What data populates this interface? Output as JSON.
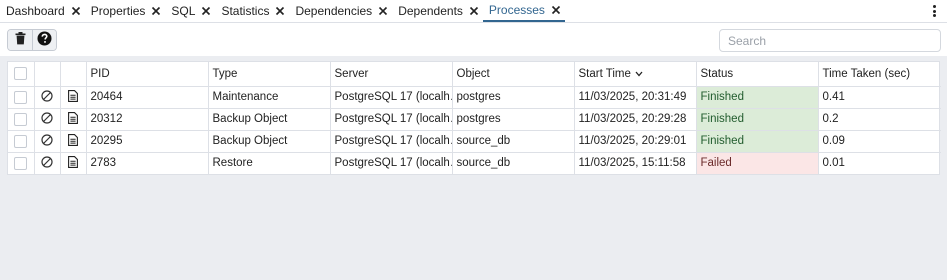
{
  "tabs": [
    {
      "label": "Dashboard",
      "active": false
    },
    {
      "label": "Properties",
      "active": false
    },
    {
      "label": "SQL",
      "active": false
    },
    {
      "label": "Statistics",
      "active": false
    },
    {
      "label": "Dependencies",
      "active": false
    },
    {
      "label": "Dependents",
      "active": false
    },
    {
      "label": "Processes",
      "active": true
    }
  ],
  "toolbar": {
    "delete_icon": "trash-icon",
    "help_icon": "help-circle-icon",
    "search_placeholder": "Search"
  },
  "table": {
    "columns": [
      "PID",
      "Type",
      "Server",
      "Object",
      "Start Time",
      "Status",
      "Time Taken (sec)"
    ],
    "sorted_column": "Start Time",
    "rows": [
      {
        "pid": "20464",
        "type": "Maintenance",
        "server": "PostgreSQL 17 (localh…",
        "object": "postgres",
        "start_time": "11/03/2025, 20:31:49",
        "status": "Finished",
        "time_taken": "0.41"
      },
      {
        "pid": "20312",
        "type": "Backup Object",
        "server": "PostgreSQL 17 (localh…",
        "object": "postgres",
        "start_time": "11/03/2025, 20:29:28",
        "status": "Finished",
        "time_taken": "0.2"
      },
      {
        "pid": "20295",
        "type": "Backup Object",
        "server": "PostgreSQL 17 (localh…",
        "object": "source_db",
        "start_time": "11/03/2025, 20:29:01",
        "status": "Finished",
        "time_taken": "0.09"
      },
      {
        "pid": "2783",
        "type": "Restore",
        "server": "PostgreSQL 17 (localh…",
        "object": "source_db",
        "start_time": "11/03/2025, 15:11:58",
        "status": "Failed",
        "time_taken": "0.01"
      }
    ]
  },
  "colors": {
    "accent": "#326690",
    "status_finished_bg": "#dcecd8",
    "status_failed_bg": "#fbe6e6"
  }
}
